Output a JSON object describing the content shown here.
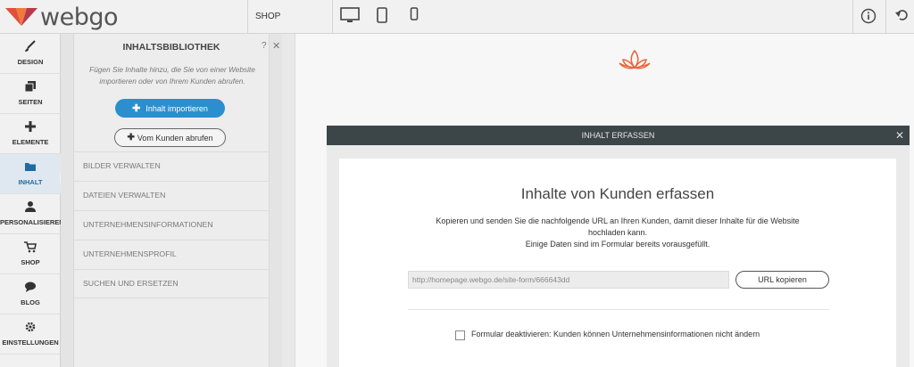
{
  "app": {
    "logo_text": "webgo"
  },
  "topbar": {
    "shop_label": "SHOP"
  },
  "nav": [
    {
      "label": "DESIGN",
      "icon": "brush-icon"
    },
    {
      "label": "SEITEN",
      "icon": "pages-icon"
    },
    {
      "label": "ELEMENTE",
      "icon": "plus-icon"
    },
    {
      "label": "INHALT",
      "icon": "folder-icon"
    },
    {
      "label": "PERSONALISIEREN",
      "icon": "person-icon"
    },
    {
      "label": "SHOP",
      "icon": "cart-icon"
    },
    {
      "label": "BLOG",
      "icon": "chat-bubble-icon"
    },
    {
      "label": "EINSTELLUNGEN",
      "icon": "gear-icon"
    }
  ],
  "library": {
    "title": "INHALTSBIBLIOTHEK",
    "help": "?",
    "close": "✕",
    "description": "Fügen Sie Inhalte hinzu, die Sie von einer Website importieren oder von Ihrem Kunden abrufen.",
    "import_button": "Inhalt importieren",
    "kunden_button": "Vom Kunden abrufen",
    "items": [
      "BILDER VERWALTEN",
      "DATEIEN VERWALTEN",
      "UNTERNEHMENSINFORMATIONEN",
      "UNTERNEHMENSPROFIL",
      "SUCHEN UND ERSETZEN"
    ]
  },
  "modal": {
    "header": "INHALT ERFASSEN",
    "close": "✕",
    "title": "Inhalte von Kunden erfassen",
    "text_line1": "Kopieren und senden Sie die nachfolgende URL an Ihren Kunden, damit dieser Inhalte für die Website",
    "text_line2": "hochladen kann.",
    "text_line3": "Einige Daten sind im Formular bereits vorausgefüllt.",
    "url_value": "http://homepage.webgo.de/site-form/666643dd",
    "copy_button": "URL kopieren",
    "checkbox_label": "Formular deaktivieren: Kunden können Unternehmensinformationen nicht ändern",
    "checkbox_checked": false
  },
  "colors": {
    "accent": "#2b8fcf",
    "active_nav": "#1e6aa3",
    "brand_orange": "#e8663d",
    "modal_header": "#3c4548"
  }
}
